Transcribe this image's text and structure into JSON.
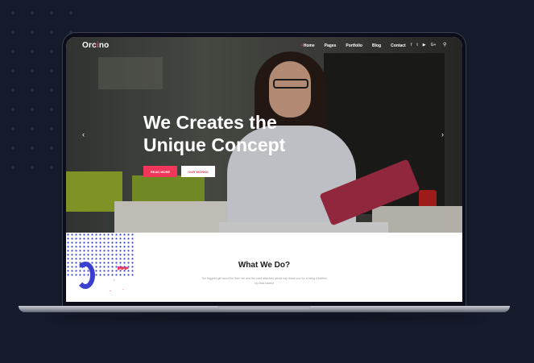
{
  "site": {
    "logo_prefix": "Orc",
    "logo_dot": "i",
    "logo_suffix": "no"
  },
  "nav": {
    "items": [
      "Home",
      "Pages",
      "Portfolio",
      "Blog",
      "Contact"
    ],
    "active": "Home"
  },
  "social": [
    "f",
    "t",
    "yt",
    "G+"
  ],
  "hero": {
    "headline_line1": "We Creates the",
    "headline_line2": "Unique Concept",
    "primary_button": "READ MORE",
    "secondary_button": "OUR WORKS"
  },
  "section": {
    "title": "What We Do?",
    "text": "The biggest gift would be from me and the card attached would say thank you for a being a faithful toy that started"
  },
  "colors": {
    "accent": "#f2385a",
    "blue": "#3a3fd0",
    "background": "#161b2c"
  }
}
